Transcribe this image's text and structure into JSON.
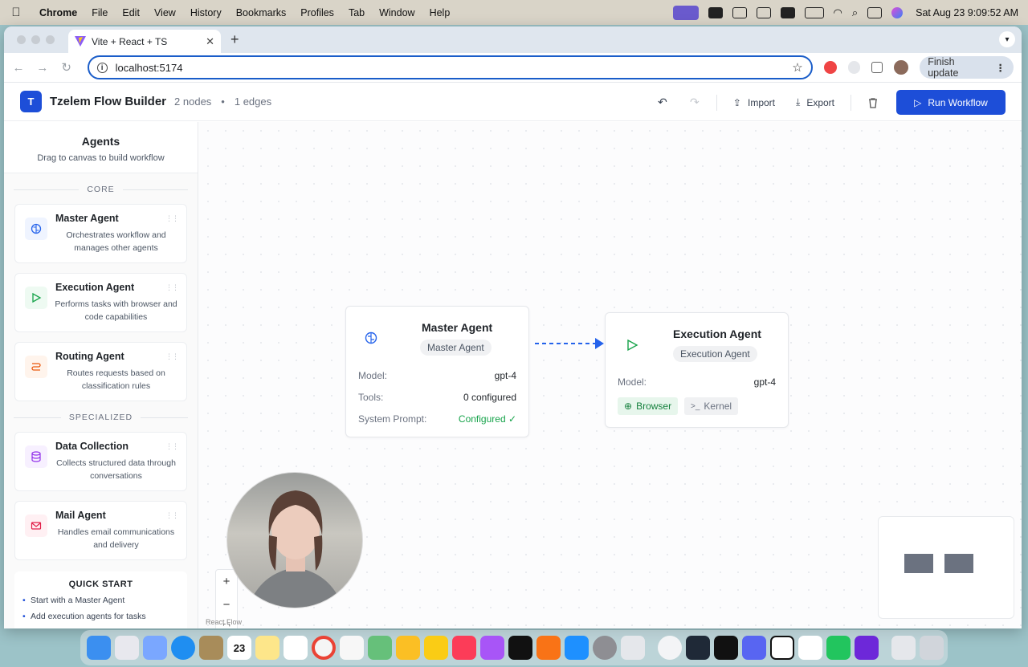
{
  "menubar": {
    "app": "Chrome",
    "items": [
      "File",
      "Edit",
      "View",
      "History",
      "Bookmarks",
      "Profiles",
      "Tab",
      "Window",
      "Help"
    ],
    "clock": "Sat Aug 23  9:09:52 AM"
  },
  "browser": {
    "tab_title": "Vite + React + TS",
    "url": "localhost:5174",
    "update_label": "Finish update"
  },
  "app": {
    "logo_letter": "T",
    "title": "Tzelem Flow Builder",
    "nodes_count": "2 nodes",
    "separator": "•",
    "edges_count": "1 edges",
    "import_label": "Import",
    "export_label": "Export",
    "run_label": "Run Workflow"
  },
  "sidebar": {
    "title": "Agents",
    "subtitle": "Drag to canvas to build workflow",
    "sections": [
      {
        "label": "CORE",
        "items": [
          {
            "name": "Master Agent",
            "desc": "Orchestrates workflow and manages other agents",
            "icon": "brain-icon",
            "color": "#2563eb",
            "bg": "#eff4ff"
          },
          {
            "name": "Execution Agent",
            "desc": "Performs tasks with browser and code capabilities",
            "icon": "play-icon",
            "color": "#16a34a",
            "bg": "#eefaf2"
          },
          {
            "name": "Routing Agent",
            "desc": "Routes requests based on classification rules",
            "icon": "route-icon",
            "color": "#ea580c",
            "bg": "#fff4ec"
          }
        ]
      },
      {
        "label": "SPECIALIZED",
        "items": [
          {
            "name": "Data Collection",
            "desc": "Collects structured data through conversations",
            "icon": "database-icon",
            "color": "#9333ea",
            "bg": "#f7f0ff"
          },
          {
            "name": "Mail Agent",
            "desc": "Handles email communications and delivery",
            "icon": "mail-icon",
            "color": "#e11d48",
            "bg": "#fff0f3"
          }
        ]
      }
    ],
    "quick_start": {
      "title": "QUICK START",
      "items": [
        "Start with a Master Agent",
        "Add execution agents for tasks"
      ]
    }
  },
  "canvas": {
    "nodes": {
      "master": {
        "title": "Master Agent",
        "badge": "Master Agent",
        "model_label": "Model:",
        "model_value": "gpt-4",
        "tools_label": "Tools:",
        "tools_value": "0 configured",
        "prompt_label": "System Prompt:",
        "prompt_value": "Configured ✓"
      },
      "execution": {
        "title": "Execution Agent",
        "badge": "Execution Agent",
        "model_label": "Model:",
        "model_value": "gpt-4",
        "chips": [
          "Browser",
          "Kernel"
        ]
      }
    },
    "attribution": "React Flow"
  },
  "colors": {
    "accent": "#1d4ed8",
    "success": "#16a34a",
    "edge": "#2563eb"
  }
}
